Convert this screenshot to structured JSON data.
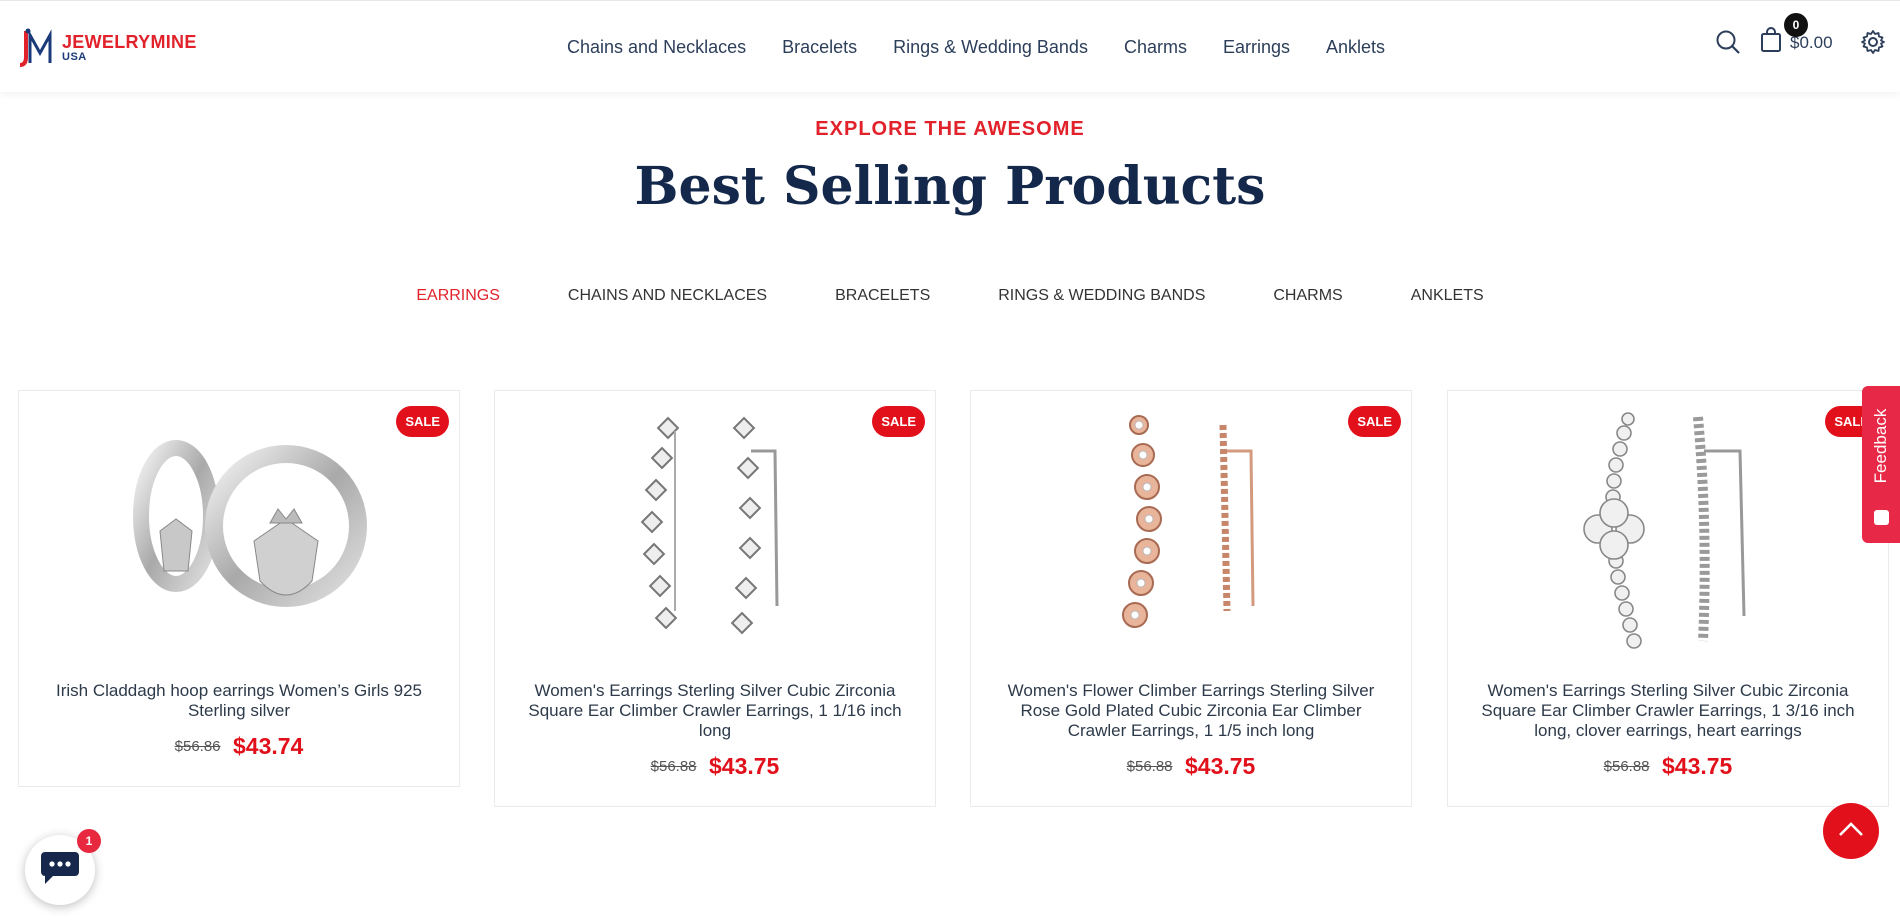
{
  "header": {
    "logo_brand": "JEWELRYMINE",
    "logo_sub": "USA",
    "nav": [
      {
        "label": "Chains and Necklaces"
      },
      {
        "label": "Bracelets"
      },
      {
        "label": "Rings & Wedding Bands"
      },
      {
        "label": "Charms"
      },
      {
        "label": "Earrings"
      },
      {
        "label": "Anklets"
      }
    ],
    "cart_count": "0",
    "cart_total": "$0.00"
  },
  "section": {
    "eyebrow": "EXPLORE THE AWESOME",
    "title": "Best Selling Products",
    "tabs": [
      {
        "label": "EARRINGS",
        "active": true
      },
      {
        "label": "CHAINS AND NECKLACES"
      },
      {
        "label": "BRACELETS"
      },
      {
        "label": "RINGS & WEDDING BANDS"
      },
      {
        "label": "CHARMS"
      },
      {
        "label": "ANKLETS"
      }
    ]
  },
  "products": [
    {
      "badge": "SALE",
      "title": "Irish Claddagh hoop earrings Women’s Girls 925 Sterling silver",
      "old_price": "$56.86",
      "price": "$43.74",
      "metal": "silver"
    },
    {
      "badge": "SALE",
      "title": "Women's Earrings Sterling Silver Cubic Zirconia Square Ear Climber Crawler Earrings, 1 1/16 inch long",
      "old_price": "$56.88",
      "price": "$43.75",
      "metal": "silver"
    },
    {
      "badge": "SALE",
      "title": "Women's Flower Climber Earrings Sterling Silver Rose Gold Plated Cubic Zirconia Ear Climber Crawler Earrings, 1 1/5 inch long",
      "old_price": "$56.88",
      "price": "$43.75",
      "metal": "rose"
    },
    {
      "badge": "SALE",
      "title": "Women's Earrings Sterling Silver Cubic Zirconia Square Ear Climber Crawler Earrings, 1 3/16 inch long, clover earrings, heart earrings",
      "old_price": "$56.88",
      "price": "$43.75",
      "metal": "silver"
    }
  ],
  "feedback_label": "Feedback",
  "chat_badge": "1",
  "colors": {
    "accent": "#e2101b",
    "title": "#13284a",
    "nav": "#2c3e5a"
  }
}
